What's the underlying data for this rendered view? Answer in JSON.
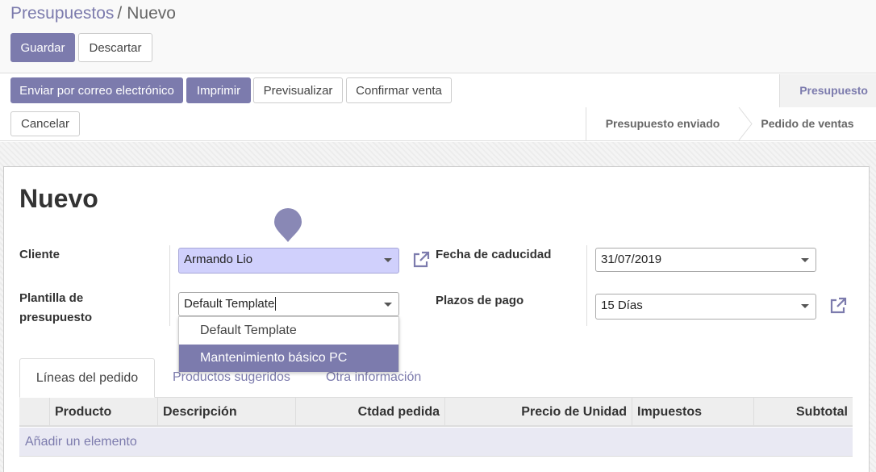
{
  "breadcrumb": {
    "parent": "Presupuestos",
    "separator": "/",
    "current": "Nuevo"
  },
  "toolbar": {
    "save_label": "Guardar",
    "discard_label": "Descartar"
  },
  "statusbar": {
    "buttons": {
      "email": "Enviar por correo electrónico",
      "print": "Imprimir",
      "preview": "Previsualizar",
      "confirm": "Confirmar venta",
      "cancel": "Cancelar"
    },
    "stages": {
      "current": "Presupuesto",
      "sent": "Presupuesto enviado",
      "sale": "Pedido de ventas"
    }
  },
  "form": {
    "title": "Nuevo",
    "customer": {
      "label": "Cliente",
      "value": "Armando Lio"
    },
    "template": {
      "label": "Plantilla de presupuesto",
      "value": "Default Template",
      "options": [
        "Default Template",
        "Mantenimiento básico PC"
      ]
    },
    "expiration": {
      "label": "Fecha de caducidad",
      "value": "31/07/2019"
    },
    "payment_terms": {
      "label": "Plazos de pago",
      "value": "15 Días"
    }
  },
  "tabs": [
    "Líneas del pedido",
    "Productos sugeridos",
    "Otra información"
  ],
  "table": {
    "headers": [
      "Producto",
      "Descripción",
      "Ctdad pedida",
      "Precio de Unidad",
      "Impuestos",
      "Subtotal"
    ],
    "add_line": "Añadir un elemento"
  },
  "colors": {
    "accent": "#7c7bad",
    "highlight": "#d0d0fc"
  }
}
